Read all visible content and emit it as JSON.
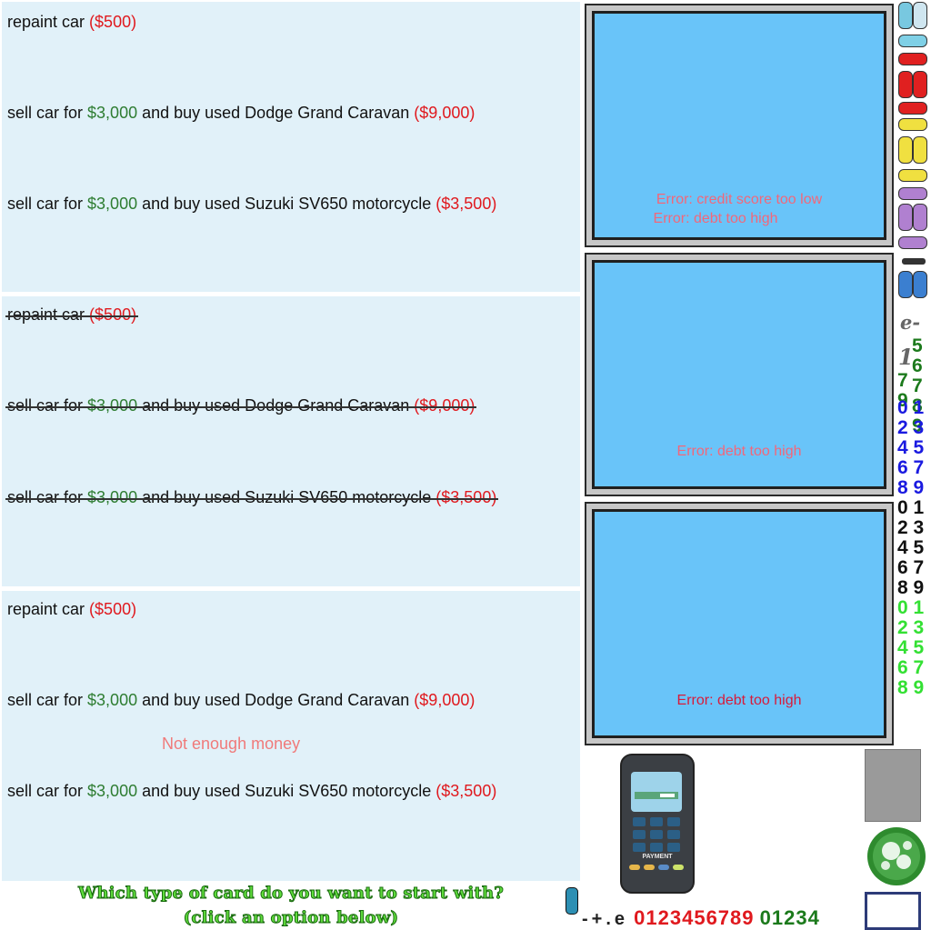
{
  "panels": [
    {
      "strikethrough": false,
      "options": [
        {
          "parts": [
            {
              "t": "repaint car",
              "c": "k"
            },
            {
              "t": "($500)",
              "c": "r"
            }
          ]
        },
        {
          "parts": [
            {
              "t": "sell car for",
              "c": "k"
            },
            {
              "t": "$3,000",
              "c": "g"
            },
            {
              "t": "and buy used Dodge Grand Caravan",
              "c": "k"
            },
            {
              "t": "($9,000)",
              "c": "r"
            }
          ]
        },
        {
          "parts": [
            {
              "t": "sell car for",
              "c": "k"
            },
            {
              "t": "$3,000",
              "c": "g"
            },
            {
              "t": "and buy used Suzuki SV650 motorcycle",
              "c": "k"
            },
            {
              "t": "($3,500)",
              "c": "r"
            }
          ]
        }
      ],
      "note": ""
    },
    {
      "strikethrough": true,
      "options": [
        {
          "parts": [
            {
              "t": "repaint car",
              "c": "k"
            },
            {
              "t": "($500)",
              "c": "r"
            }
          ]
        },
        {
          "parts": [
            {
              "t": "sell car for",
              "c": "k"
            },
            {
              "t": "$3,000",
              "c": "g"
            },
            {
              "t": "and buy used Dodge Grand Caravan",
              "c": "k"
            },
            {
              "t": "($9,000)",
              "c": "r"
            }
          ]
        },
        {
          "parts": [
            {
              "t": "sell car for",
              "c": "k"
            },
            {
              "t": "$3,000",
              "c": "g"
            },
            {
              "t": "and buy used Suzuki SV650 motorcycle",
              "c": "k"
            },
            {
              "t": "($3,500)",
              "c": "r"
            }
          ]
        }
      ],
      "note": ""
    },
    {
      "strikethrough": false,
      "options": [
        {
          "parts": [
            {
              "t": "repaint car",
              "c": "k"
            },
            {
              "t": "($500)",
              "c": "r"
            }
          ]
        },
        {
          "parts": [
            {
              "t": "sell car for",
              "c": "k"
            },
            {
              "t": "$3,000",
              "c": "g"
            },
            {
              "t": "and buy used Dodge Grand Caravan",
              "c": "k"
            },
            {
              "t": "($9,000)",
              "c": "r"
            }
          ]
        },
        {
          "parts": [
            {
              "t": "sell car for",
              "c": "k"
            },
            {
              "t": "$3,000",
              "c": "g"
            },
            {
              "t": "and buy used Suzuki SV650 motorcycle",
              "c": "k"
            },
            {
              "t": "($3,500)",
              "c": "r"
            }
          ]
        }
      ],
      "note": "Not enough money"
    }
  ],
  "prompt": {
    "line1": "Which type of card do you want to start with?",
    "line2": "(click an option below)"
  },
  "screens": [
    {
      "errors": [
        "Error: credit score too low",
        "Error: debt too high"
      ]
    },
    {
      "errors": [
        "Error: debt too high"
      ]
    },
    {
      "errors": [
        "Error: debt too high"
      ]
    }
  ],
  "terminal": {
    "label": "PAYMENT"
  },
  "font_sheet": {
    "grey_chars": "e-",
    "grey_one": "1",
    "green_dark_a": "5 6 7 8 9",
    "blue": "0 1 2 3 4 5 6 7 8 9",
    "black": "0 1 2 3 4 5 6 7 8 9",
    "bright_green": "0 1 2 3 4 5 6 7 8 9"
  },
  "bottom_digits": {
    "symbols": "-+.e",
    "red": "0123456789",
    "green": "01234"
  },
  "colors": {
    "panel_bg": "#e1f1f9",
    "money_green": "#2e7d32",
    "price_red": "#e0191e",
    "screen_blue": "#69c4f9",
    "error_pink": "#f2677a"
  }
}
